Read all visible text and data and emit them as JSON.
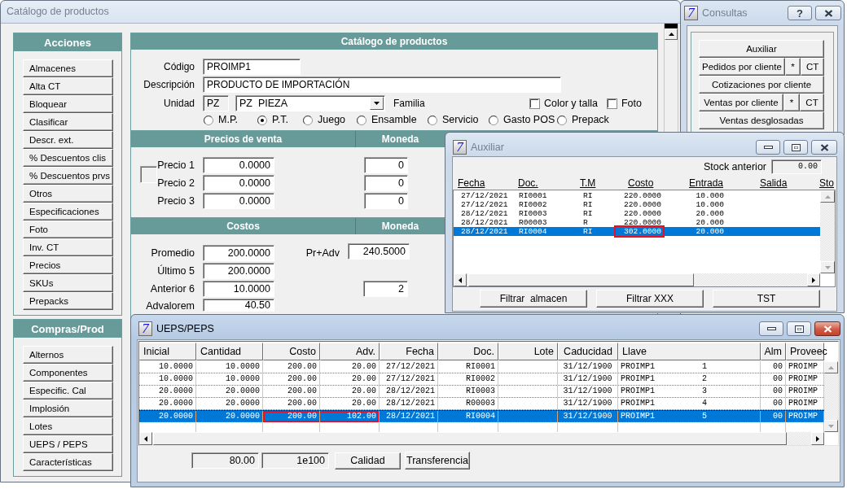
{
  "main_window": {
    "title": "Catálogo de productos",
    "active": false,
    "side_panels": [
      {
        "heading": "Acciones",
        "items": [
          "Almacenes",
          "Alta CT",
          "Bloquear",
          "Clasificar",
          "Descr. ext.",
          "% Descuentos clis",
          "% Descuentos prvs",
          "Otros",
          "Especificaciones",
          "Foto",
          "Inv. CT",
          "Precios",
          "SKUs",
          "Prepacks"
        ]
      },
      {
        "heading": "Compras/Prod",
        "items": [
          "Alternos",
          "Componentes",
          "Especific. Cal",
          "Implosión",
          "Lotes",
          "UEPS / PEPS",
          "Características"
        ]
      }
    ],
    "product": {
      "heading": "Catálogo de productos",
      "codigo": {
        "label": "Código",
        "value": "PROIMP1"
      },
      "descripcion": {
        "label": "Descripción",
        "value": "PRODUCTO DE IMPORTACIÓN"
      },
      "unidad": {
        "label": "Unidad",
        "code": "PZ",
        "value": "PZ  PIEZA"
      },
      "familia": {
        "label": "Familia"
      },
      "checkboxes": [
        {
          "label": "Color y talla",
          "checked": false
        },
        {
          "label": "Foto",
          "checked": false
        }
      ],
      "tipo": [
        {
          "label": "M.P.",
          "selected": false
        },
        {
          "label": "P.T.",
          "selected": true
        },
        {
          "label": "Juego",
          "selected": false
        },
        {
          "label": "Ensamble",
          "selected": false
        },
        {
          "label": "Servicio",
          "selected": false
        },
        {
          "label": "Gasto POS",
          "selected": false
        },
        {
          "label": "Prepack",
          "selected": false
        }
      ]
    },
    "precios": {
      "heading": "Precios de venta",
      "moneda_heading": "Moneda",
      "rows": [
        {
          "label": "Precio 1",
          "value": "0.0000",
          "moneda": "0"
        },
        {
          "label": "Precio 2",
          "value": "0.0000",
          "moneda": "0"
        },
        {
          "label": "Precio 3",
          "value": "0.0000",
          "moneda": "0"
        }
      ]
    },
    "costos": {
      "heading": "Costos",
      "moneda_heading": "Moneda",
      "pr_adv": {
        "label": "Pr+Adv",
        "value": "240.5000"
      },
      "rows": [
        {
          "label": "Promedio",
          "value": "200.0000"
        },
        {
          "label": "Último 5",
          "value": "200.0000"
        },
        {
          "label": "Anterior 6",
          "value": "10.0000",
          "moneda": "2"
        },
        {
          "label": "Advalorem",
          "value": "40.50"
        }
      ]
    }
  },
  "consultas": {
    "logo": "7",
    "title": "Consultas",
    "active": false,
    "help": "?",
    "buttons": [
      {
        "label": "Auxiliar"
      },
      {
        "label": "Pedidos por cliente",
        "extras": [
          "*",
          "CT"
        ]
      },
      {
        "label": "Cotizaciones por cliente"
      },
      {
        "label": "Ventas por cliente",
        "extras": [
          "*",
          "CT"
        ]
      },
      {
        "label": "Ventas desglosadas"
      }
    ]
  },
  "auxiliar": {
    "logo": "7",
    "title": "Auxiliar",
    "active": false,
    "stock_anterior": {
      "label": "Stock anterior",
      "value": "0.00"
    },
    "columns": [
      "Fecha",
      "Doc.",
      "T.M",
      "Costo",
      "Entrada",
      "Salida",
      "Sto"
    ],
    "rows": [
      {
        "fecha": "27/12/2021",
        "doc": "RI0001",
        "tm": "RI",
        "costo": "220.0000",
        "entrada": "10.000",
        "selected": false
      },
      {
        "fecha": "27/12/2021",
        "doc": "RI0002",
        "tm": "RI",
        "costo": "220.0000",
        "entrada": "10.000",
        "selected": false
      },
      {
        "fecha": "28/12/2021",
        "doc": "RI0003",
        "tm": "RI",
        "costo": "220.0000",
        "entrada": "20.000",
        "selected": false
      },
      {
        "fecha": "28/12/2021",
        "doc": "R00003",
        "tm": "R",
        "costo": "220.0000",
        "entrada": "20.000",
        "selected": false
      },
      {
        "fecha": "28/12/2021",
        "doc": "RI0004",
        "tm": "RI",
        "costo": "302.0000",
        "entrada": "20.000",
        "selected": true,
        "marked": {
          "costo": true
        }
      }
    ],
    "buttons": [
      "Filtrar  almacen",
      "Filtrar XXX",
      "TST"
    ]
  },
  "ueps": {
    "logo": "7",
    "title": "UEPS/PEPS",
    "active": true,
    "columns": [
      "Inicial",
      "Cantidad",
      "Costo",
      "Adv.",
      "Fecha",
      "Doc.",
      "Lote",
      "Caducidad",
      "Llave",
      "Alm",
      "Proveec"
    ],
    "rows": [
      {
        "inicial": "10.0000",
        "cantidad": "10.0000",
        "costo": "200.00",
        "adv": "20.00",
        "fecha": "27/12/2021",
        "doc": "RI0001",
        "caducidad": "31/12/1900",
        "llave": "PROIMP1",
        "llave_num": "1",
        "alm": "00",
        "proveedor": "PROIMP",
        "selected": false
      },
      {
        "inicial": "10.0000",
        "cantidad": "10.0000",
        "costo": "200.00",
        "adv": "20.00",
        "fecha": "27/12/2021",
        "doc": "RI0002",
        "caducidad": "31/12/1900",
        "llave": "PROIMP1",
        "llave_num": "2",
        "alm": "00",
        "proveedor": "PROIMP",
        "selected": false
      },
      {
        "inicial": "20.0000",
        "cantidad": "20.0000",
        "costo": "200.00",
        "adv": "20.00",
        "fecha": "28/12/2021",
        "doc": "RI0003",
        "caducidad": "31/12/1900",
        "llave": "PROIMP1",
        "llave_num": "3",
        "alm": "00",
        "proveedor": "PROIMP",
        "selected": false
      },
      {
        "inicial": "20.0000",
        "cantidad": "20.0000",
        "costo": "200.00",
        "adv": "20.00",
        "fecha": "28/12/2021",
        "doc": "R00003",
        "caducidad": "31/12/1900",
        "llave": "PROIMP1",
        "llave_num": "4",
        "alm": "00",
        "proveedor": "PROIMP",
        "selected": false
      },
      {
        "inicial": "20.0000",
        "cantidad": "20.0000",
        "costo": "200.00",
        "adv": "102.00",
        "fecha": "28/12/2021",
        "doc": "RI0004",
        "caducidad": "31/12/1900",
        "llave": "PROIMP1",
        "llave_num": "5",
        "alm": "00",
        "proveedor": "PROIMP",
        "selected": true,
        "marked": {
          "costo": true,
          "adv": true
        }
      }
    ],
    "totals": [
      "80.00",
      "1e100"
    ],
    "buttons": [
      "Calidad",
      "Transferencia"
    ]
  }
}
